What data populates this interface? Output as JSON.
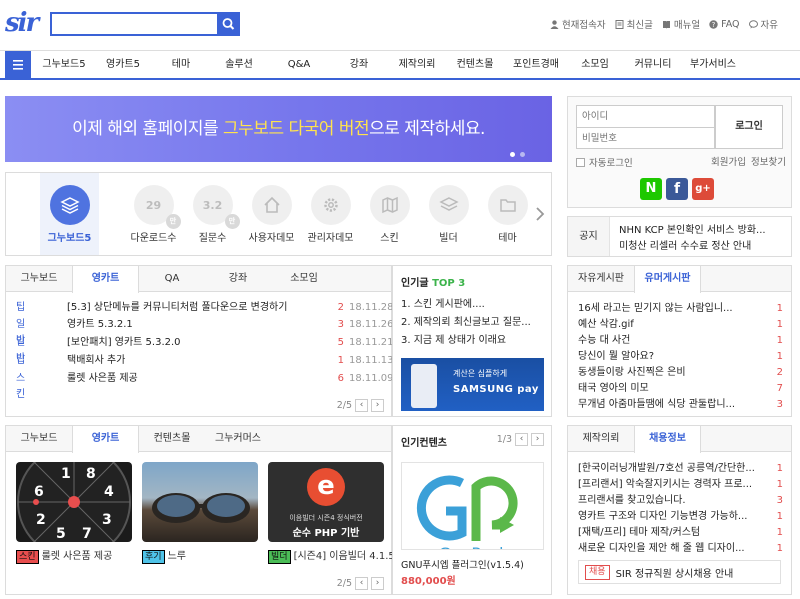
{
  "header": {
    "logo": "sir",
    "search": {
      "value": "",
      "placeholder": ""
    },
    "links": [
      {
        "icon": "user-icon",
        "label": "현재접속자"
      },
      {
        "icon": "document-icon",
        "label": "최신글"
      },
      {
        "icon": "book-icon",
        "label": "매뉴얼"
      },
      {
        "icon": "question-icon",
        "label": "FAQ"
      },
      {
        "icon": "chat-icon",
        "label": "자유"
      }
    ]
  },
  "nav": {
    "items": [
      "그누보드5",
      "영카트5",
      "테마",
      "솔루션",
      "Q&A",
      "강좌",
      "제작의뢰",
      "컨텐츠몰",
      "포인트경매",
      "소모임",
      "커뮤니티",
      "부가서비스"
    ]
  },
  "banner": {
    "text_before": "이제 해외 홈페이지를 ",
    "text_highlight": "그누보드 다국어 버전",
    "text_after": "으로 제작하세요."
  },
  "icons": [
    {
      "name": "stack-icon",
      "label": "그누보드5",
      "value": "",
      "active": true
    },
    {
      "name": "download-count-icon",
      "label": "다운로드수",
      "value": "29",
      "badge": "만",
      "active": false
    },
    {
      "name": "question-count-icon",
      "label": "질문수",
      "value": "3.2",
      "badge": "만",
      "active": false
    },
    {
      "name": "home-icon",
      "label": "사용자데모",
      "value": "",
      "active": false
    },
    {
      "name": "gear-icon",
      "label": "관리자데모",
      "value": "",
      "active": false
    },
    {
      "name": "map-icon",
      "label": "스킨",
      "value": "",
      "active": false
    },
    {
      "name": "layers-icon",
      "label": "빌더",
      "value": "",
      "active": false
    },
    {
      "name": "folder-icon",
      "label": "테마",
      "value": "",
      "active": false
    }
  ],
  "login": {
    "id_placeholder": "아이디",
    "pw_placeholder": "비밀번호",
    "login_button": "로그인",
    "auto_login": "자동로그인",
    "join": "회원가입",
    "find": "정보찾기",
    "social": [
      {
        "name": "naver-icon",
        "label": "N",
        "color": "#1ec800"
      },
      {
        "name": "facebook-icon",
        "label": "f",
        "color": "#3b5998"
      },
      {
        "name": "google-plus-icon",
        "label": "g+",
        "color": "#dd4b39"
      }
    ]
  },
  "notice": {
    "label": "공지",
    "items": [
      "NHN KCP 본인확인 서비스 방화...",
      "미청산 리셀러 수수료 정산 안내"
    ]
  },
  "board1": {
    "tabs": [
      "그누보드",
      "영카트",
      "QA",
      "강좌",
      "소모임"
    ],
    "active": 1,
    "rows": [
      {
        "cat": "팁",
        "title": "[5.3] 상단메뉴를 커뮤니티처럼 풀다운으로 변경하기",
        "count": "2",
        "date": "18.11.28"
      },
      {
        "cat": "일반",
        "title": "영카트 5.3.2.1",
        "count": "3",
        "date": "18.11.26"
      },
      {
        "cat": "일반",
        "title": "[보안패치] 영카트 5.3.2.0",
        "count": "5",
        "date": "18.11.21"
      },
      {
        "cat": "팁",
        "title": "택배회사 추가",
        "count": "1",
        "date": "18.11.13"
      },
      {
        "cat": "스킨",
        "title": "룰렛 사은품 제공",
        "count": "6",
        "date": "18.11.09"
      }
    ],
    "page": "2/5"
  },
  "popular": {
    "title": "인기글",
    "top": "TOP 3",
    "items": [
      "1. 스킨 게시판에....",
      "2. 제작의뢰 최신글보고 질문...",
      "3. 지금 제 상태가 이래요"
    ],
    "ad": {
      "text": "계산은 심플하게",
      "brand": "SAMSUNG pay"
    }
  },
  "board2": {
    "tabs": [
      "그누보드",
      "영카트",
      "컨텐츠몰",
      "그누커머스"
    ],
    "active": 1,
    "items": [
      {
        "tag": "스킨",
        "tag_color": "#e84e4e",
        "title": "룰렛 사은품 제공"
      },
      {
        "tag": "후기",
        "tag_color": "#4a9ee8",
        "title": "느루"
      },
      {
        "tag": "빌더",
        "tag_color": "#4bbd57",
        "title": "[시즌4] 이음빌더 4.1.5"
      }
    ],
    "thumb3": {
      "line1": "이음빌더 시즌4 정식버전",
      "line2": "순수 PHP 기반"
    },
    "page": "2/5"
  },
  "content": {
    "title": "인기컨텐츠",
    "page": "1/3",
    "item_title": "GNU푸시엡 플러그인(v1.5.4)",
    "price": "880,000원"
  },
  "freeboard": {
    "tabs": [
      "자유게시판",
      "유머게시판"
    ],
    "active": 1,
    "rows": [
      {
        "title": "16세 라고는 믿기지 않는 사람입니...",
        "count": "1"
      },
      {
        "title": "예산 삭감.gif",
        "count": "1"
      },
      {
        "title": "수능 대 사건",
        "count": "1"
      },
      {
        "title": "당신이 뭘 알아요?",
        "count": "1"
      },
      {
        "title": "동생들이랑 사진찍은 은비",
        "count": "2"
      },
      {
        "title": "태국 영아의 미모",
        "count": "7"
      },
      {
        "title": "무개념 아줌마들땜에 식당 관둘랍니...",
        "count": "3"
      }
    ]
  },
  "jobs": {
    "tabs": [
      "제작의뢰",
      "채용정보"
    ],
    "active": 1,
    "rows": [
      {
        "title": "[한국이러닝개발원/7호선 공릉역/간단한...",
        "count": "1"
      },
      {
        "title": "[프리랜서] 악숙잘지키시는 경력자 프로...",
        "count": "1"
      },
      {
        "title": "프리랜서를 찾고있습니다.",
        "count": "3"
      },
      {
        "title": "영카트 구조와 디자인 기능변경 가능하...",
        "count": "1"
      },
      {
        "title": "[재택/프리] 테마 제작/커스텀",
        "count": "1"
      },
      {
        "title": "새로운 디자인을 제안 해 줄 웹 디자이...",
        "count": "1"
      }
    ],
    "notice_tag": "채용",
    "notice_text": "SIR 정규직원 상시채용 안내"
  }
}
